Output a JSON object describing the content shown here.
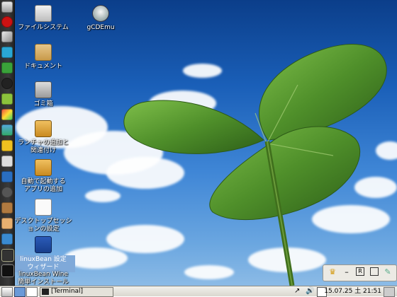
{
  "desktop_icons": [
    {
      "label": "ファイルシステム",
      "icon": "drive-icon"
    },
    {
      "label": "gCDEmu",
      "icon": "gcdemu-icon"
    },
    {
      "label": "ドキュメント",
      "icon": "folder-icon"
    },
    {
      "label": "ゴミ箱",
      "icon": "trash-icon"
    },
    {
      "label": "ランチャの追加と\n関連付け",
      "icon": "launcher-icon"
    },
    {
      "label": "自動で起動する\nアプリの追加",
      "icon": "autostart-icon"
    },
    {
      "label": "デスクトップセッシ\nョンの設定",
      "icon": "session-icon"
    },
    {
      "label": "linuxBean 設定\nウィザード",
      "icon": "wizard-icon"
    },
    {
      "label": "linuxBean Wine\n簡単インストール",
      "icon": "wine-icon"
    }
  ],
  "taskbar": {
    "task_label": "[Terminal]",
    "clock": "15.07.25 土 21:51"
  },
  "dock_icons": [
    "opera-icon",
    "pencil-icon",
    "network-icon",
    "green-app-icon",
    "camera-icon",
    "android-icon",
    "paint-icon",
    "image-icon",
    "bird-icon",
    "paper-icon",
    "wifi-icon",
    "settings-icon",
    "box-icon",
    "person-icon",
    "network-share-icon",
    "monitor-icon",
    "terminal-icon"
  ],
  "colors": {
    "sky_top": "#0b3e8a",
    "leaf": "#4f8f2a",
    "taskbar": "#e6e4dc",
    "selection": "#7fa9d9"
  }
}
